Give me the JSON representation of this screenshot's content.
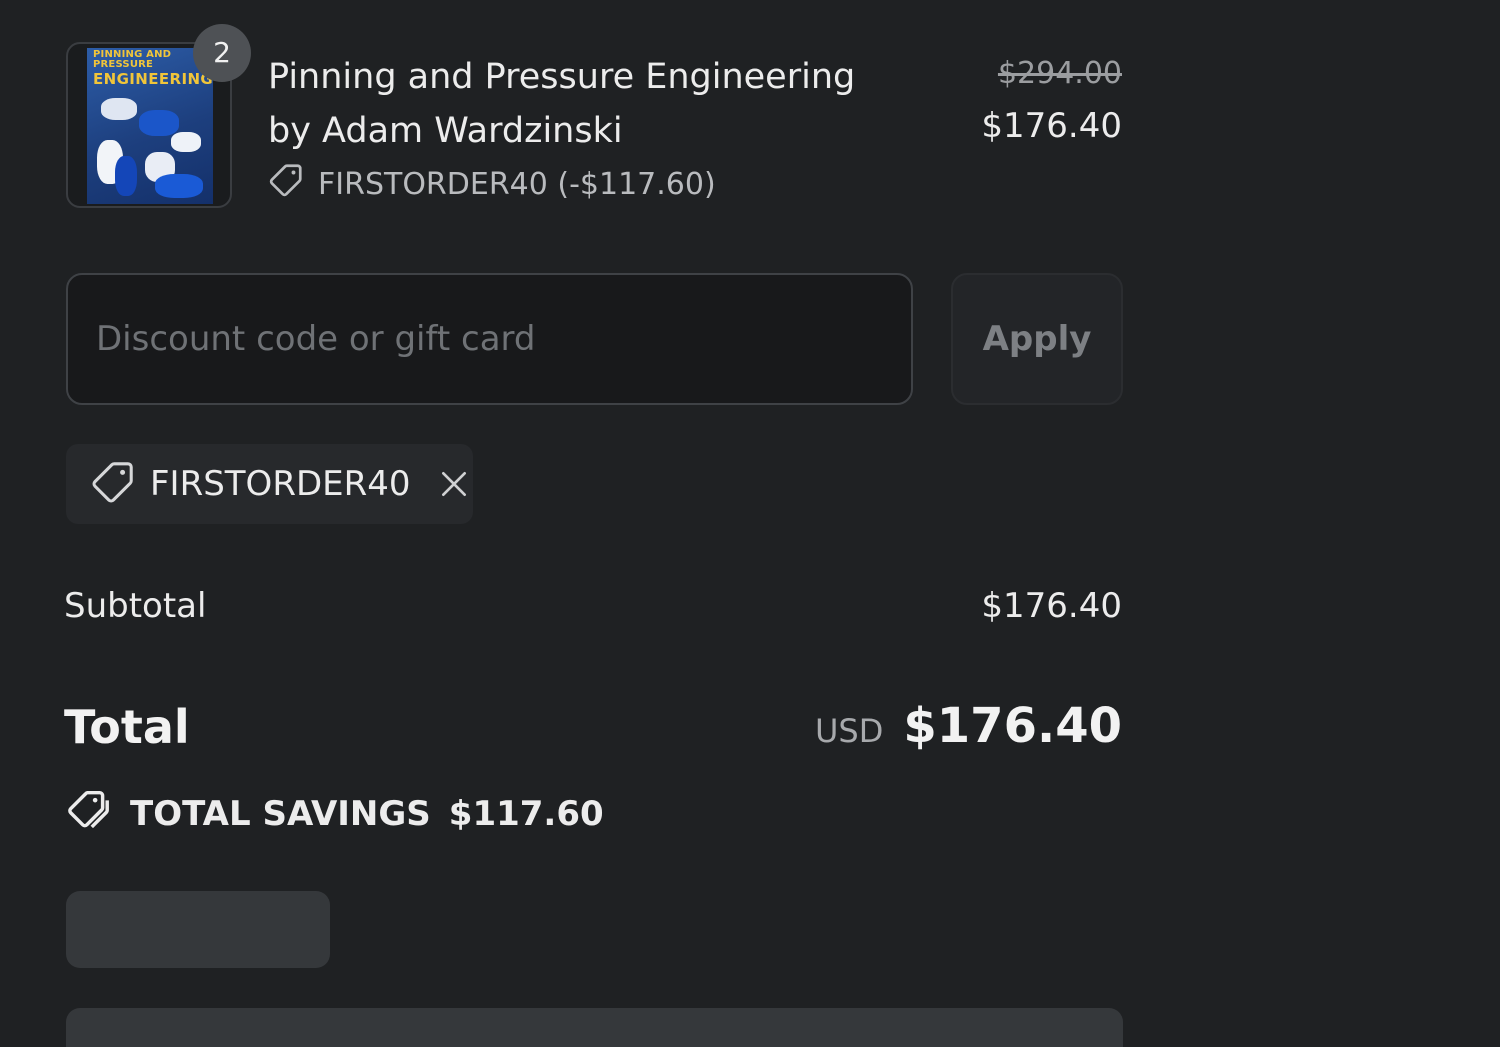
{
  "product": {
    "quantity_badge": "2",
    "name": "Pinning and Pressure Engineering by Adam Wardzinski",
    "thumbnail_title_line1": "PINNING AND PRESSURE",
    "thumbnail_title_line2": "ENGINEERING",
    "discount_label": "FIRSTORDER40 (-$117.60)",
    "price_original": "$294.00",
    "price_final": "$176.40"
  },
  "discount_form": {
    "placeholder": "Discount code or gift card",
    "value": "",
    "apply_label": "Apply"
  },
  "applied_code": {
    "label": "FIRSTORDER40"
  },
  "summary": {
    "subtotal_label": "Subtotal",
    "subtotal_value": "$176.40",
    "total_label": "Total",
    "currency": "USD",
    "total_value": "$176.40",
    "savings_label": "TOTAL SAVINGS",
    "savings_value": "$117.60"
  },
  "icons": {
    "tag": "tag-icon",
    "close": "close-icon",
    "tags": "tags-icon"
  },
  "colors": {
    "background": "#1f2123",
    "text": "#ececec",
    "muted": "#9b9da0",
    "input_bg": "#18191b",
    "skeleton": "#35383b",
    "badge": "#4e5155"
  }
}
